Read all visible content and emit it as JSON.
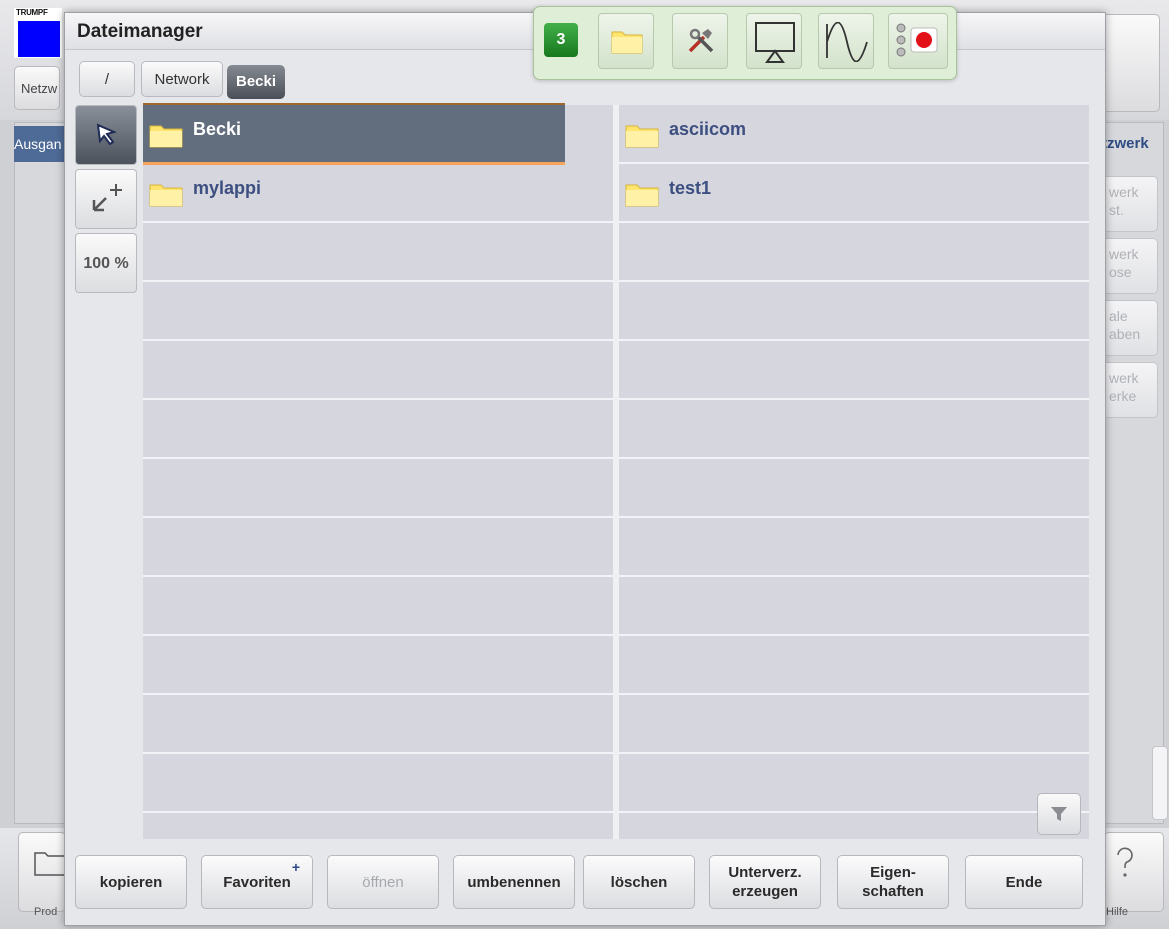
{
  "background": {
    "logo_text": "TRUMPF",
    "top_left_button": "Netzw",
    "left_panel_header": "Ausgan",
    "right_panel_header": "tzwerk",
    "side_buttons": [
      {
        "line1": "werk",
        "line2": "st."
      },
      {
        "line1": "werk",
        "line2": "ose"
      },
      {
        "line1": "ale",
        "line2": "aben"
      },
      {
        "line1": "werk",
        "line2": "erke"
      }
    ],
    "bottom_left_label": "Prod",
    "bottom_right_label": "Hilfe"
  },
  "dialog": {
    "title": "Dateimanager",
    "breadcrumbs": [
      "/",
      "Network",
      "Becki"
    ],
    "zoom_label": "100 %",
    "left_column": [
      {
        "name": "Becki",
        "selected": true
      },
      {
        "name": "mylappi",
        "selected": false
      }
    ],
    "right_column": [
      {
        "name": "asciicom",
        "selected": false
      },
      {
        "name": "test1",
        "selected": false
      }
    ],
    "buttons": [
      {
        "label": "kopieren",
        "enabled": true
      },
      {
        "label": "Favoriten",
        "enabled": true
      },
      {
        "label": "öffnen",
        "enabled": false
      },
      {
        "label": "umbenennen",
        "enabled": true
      },
      {
        "label": "löschen",
        "enabled": true
      },
      {
        "label": "Unterverz. erzeugen",
        "enabled": true
      },
      {
        "label": "Eigen- schaften",
        "enabled": true
      },
      {
        "label": "Ende",
        "enabled": true
      }
    ]
  },
  "toolbar": {
    "badge_count": "3",
    "icons": [
      "folder-icon",
      "tools-icon",
      "monitor-icon",
      "waveform-icon",
      "record-status-icon"
    ]
  },
  "colors": {
    "selection": "#626d7d",
    "selection_accent": "#f6a45a",
    "folder_text": "#3c4f80",
    "badge_green": "#2a9a32"
  }
}
